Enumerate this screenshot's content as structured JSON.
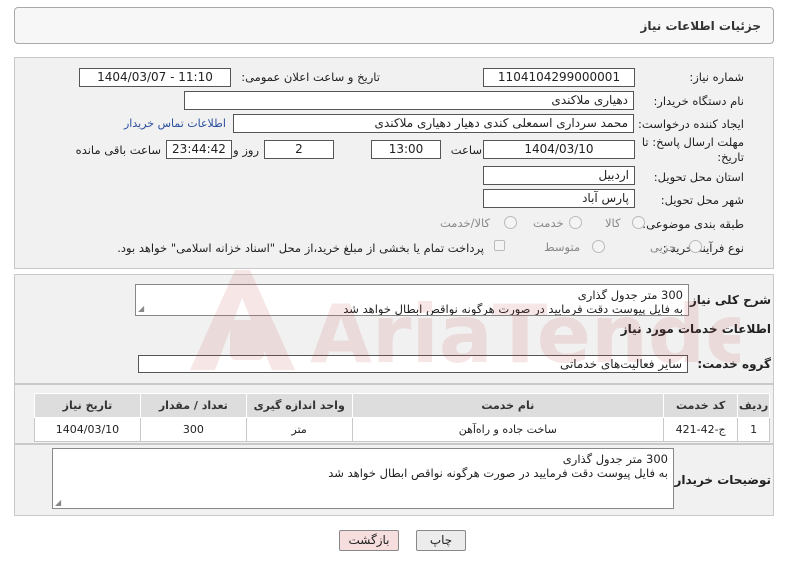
{
  "header": {
    "title": "جزئیات اطلاعات نیاز"
  },
  "form": {
    "need_number_label": "شماره نیاز:",
    "need_number": "1104104299000001",
    "announce_label": "تاریخ و ساعت اعلان عمومی:",
    "announce_value": "1404/03/07 - 11:10",
    "buyer_org_label": "نام دستگاه خریدار:",
    "buyer_org": "دهیاری ملاکندی",
    "creator_label": "ایجاد کننده درخواست:",
    "creator": "محمد سرداری اسمعلی کندی دهیار دهیاری ملاکندی",
    "contact_link": "اطلاعات تماس خریدار",
    "deadline_label_1": "مهلت ارسال پاسخ: تا",
    "deadline_label_2": "تاریخ:",
    "deadline_date": "1404/03/10",
    "time_label": "ساعت",
    "deadline_time": "13:00",
    "days_value": "2",
    "days_label": "روز و",
    "remaining_time": "23:44:42",
    "remaining_label": "ساعت باقی مانده",
    "province_label": "استان محل تحویل:",
    "province": "اردبیل",
    "city_label": "شهر محل تحویل:",
    "city": "پارس آباد",
    "category_label": "طبقه بندی موضوعی:",
    "category_options": [
      "کالا",
      "خدمت",
      "کالا/خدمت"
    ],
    "purchase_type_label": "نوع فرآیند خرید :",
    "purchase_options": [
      "جزیی",
      "متوسط"
    ],
    "payment_note": "پرداخت تمام یا بخشی از مبلغ خرید،از محل \"اسناد خزانه اسلامی\" خواهد بود."
  },
  "summary": {
    "label": "شرح کلی نیاز:",
    "text": "300 متر جدول گذاری\nبه فایل پیوست دقت فرمایید در صورت هرگونه نواقص ابطال خواهد شد"
  },
  "services": {
    "section_title": "اطلاعات خدمات مورد نیاز",
    "group_label": "گروه خدمت:",
    "group_value": "سایر فعالیت‌های خدماتی",
    "columns": [
      "ردیف",
      "کد خدمت",
      "نام خدمت",
      "واحد اندازه گیری",
      "تعداد / مقدار",
      "تاریخ نیاز"
    ],
    "rows": [
      [
        "1",
        "ج-42-421",
        "ساخت جاده و راه‌آهن",
        "متر",
        "300",
        "1404/03/10"
      ]
    ]
  },
  "buyer_notes": {
    "label": "توضیحات خریدار:",
    "text": "300 متر جدول گذاری\nبه فایل پیوست دقت فرمایید در صورت هرگونه نواقص ابطال خواهد شد"
  },
  "buttons": {
    "print": "چاپ",
    "back": "بازگشت"
  },
  "watermark": {
    "text": "AriaTender.neT"
  },
  "colors": {
    "link": "#2a4fa0",
    "back_button": "#f7dede",
    "print_button": "#ececec"
  }
}
